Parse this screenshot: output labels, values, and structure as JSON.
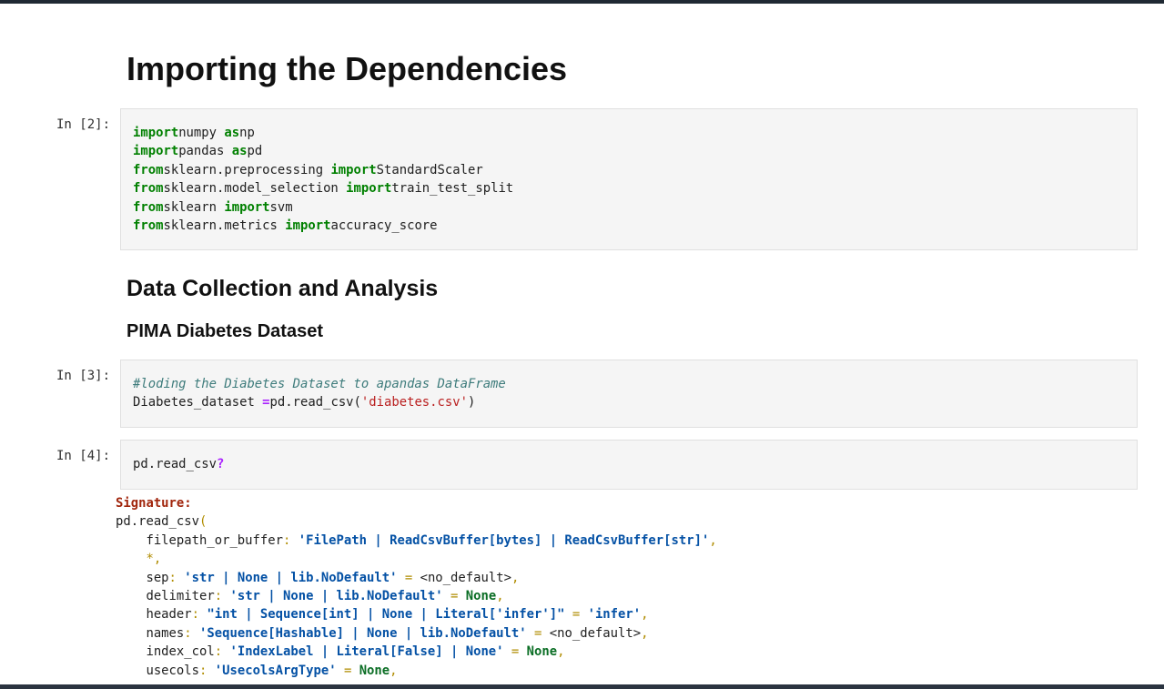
{
  "headings": {
    "h1": "Importing the Dependencies",
    "h2": "Data Collection and Analysis",
    "h3": "PIMA Diabetes Dataset"
  },
  "cells": [
    {
      "prompt": "In [2]:",
      "lines": [
        [
          [
            "kw",
            "import"
          ],
          [
            "",
            "numpy "
          ],
          [
            "kw",
            "as"
          ],
          [
            "",
            "np"
          ]
        ],
        [
          [
            "kw",
            "import"
          ],
          [
            "",
            "pandas "
          ],
          [
            "kw",
            "as"
          ],
          [
            "",
            "pd"
          ]
        ],
        [
          [
            "kw",
            "from"
          ],
          [
            "",
            "sklearn.preprocessing "
          ],
          [
            "kw",
            "import"
          ],
          [
            "",
            "StandardScaler"
          ]
        ],
        [
          [
            "kw",
            "from"
          ],
          [
            "",
            "sklearn.model_selection "
          ],
          [
            "kw",
            "import"
          ],
          [
            "",
            "train_test_split"
          ]
        ],
        [
          [
            "kw",
            "from"
          ],
          [
            "",
            "sklearn "
          ],
          [
            "kw",
            "import"
          ],
          [
            "",
            "svm"
          ]
        ],
        [
          [
            "kw",
            "from"
          ],
          [
            "",
            "sklearn.metrics "
          ],
          [
            "kw",
            "import"
          ],
          [
            "",
            "accuracy_score"
          ]
        ]
      ]
    },
    {
      "prompt": "In [3]:",
      "lines": [
        [
          [
            "cm",
            "#loding the Diabetes Dataset to apandas DataFrame"
          ]
        ],
        [
          [
            "",
            "Diabetes_dataset "
          ],
          [
            "op",
            "="
          ],
          [
            "",
            "pd.read_csv("
          ],
          [
            "st",
            "'diabetes.csv'"
          ],
          [
            "",
            ")"
          ]
        ]
      ]
    },
    {
      "prompt": "In [4]:",
      "lines": [
        [
          [
            "",
            "pd.read_csv"
          ],
          [
            "op",
            "?"
          ]
        ]
      ]
    }
  ],
  "output": {
    "lines": [
      [
        [
          "sigl",
          "Signature:"
        ]
      ],
      [
        [
          "",
          "pd.read_csv"
        ],
        [
          "pu",
          "("
        ]
      ],
      [
        [
          "",
          "    filepath_or_buffer"
        ],
        [
          "pu",
          ":"
        ],
        [
          "",
          " "
        ],
        [
          "ann",
          "'FilePath | ReadCsvBuffer[bytes] | ReadCsvBuffer[str]'"
        ],
        [
          "pu",
          ","
        ]
      ],
      [
        [
          "",
          "    "
        ],
        [
          "pu",
          "*,"
        ]
      ],
      [
        [
          "",
          "    sep"
        ],
        [
          "pu",
          ":"
        ],
        [
          "",
          " "
        ],
        [
          "ann",
          "'str | None | lib.NoDefault'"
        ],
        [
          "",
          " "
        ],
        [
          "pu",
          "="
        ],
        [
          "",
          " <no_default>"
        ],
        [
          "pu",
          ","
        ]
      ],
      [
        [
          "",
          "    delimiter"
        ],
        [
          "pu",
          ":"
        ],
        [
          "",
          " "
        ],
        [
          "ann",
          "'str | None | lib.NoDefault'"
        ],
        [
          "",
          " "
        ],
        [
          "pu",
          "="
        ],
        [
          "",
          " "
        ],
        [
          "def",
          "None"
        ],
        [
          "pu",
          ","
        ]
      ],
      [
        [
          "",
          "    header"
        ],
        [
          "pu",
          ":"
        ],
        [
          "",
          " "
        ],
        [
          "ann",
          "\"int | Sequence[int] | None | Literal['infer']\""
        ],
        [
          "",
          " "
        ],
        [
          "pu",
          "="
        ],
        [
          "",
          " "
        ],
        [
          "ann",
          "'infer'"
        ],
        [
          "pu",
          ","
        ]
      ],
      [
        [
          "",
          "    names"
        ],
        [
          "pu",
          ":"
        ],
        [
          "",
          " "
        ],
        [
          "ann",
          "'Sequence[Hashable] | None | lib.NoDefault'"
        ],
        [
          "",
          " "
        ],
        [
          "pu",
          "="
        ],
        [
          "",
          " <no_default>"
        ],
        [
          "pu",
          ","
        ]
      ],
      [
        [
          "",
          "    index_col"
        ],
        [
          "pu",
          ":"
        ],
        [
          "",
          " "
        ],
        [
          "ann",
          "'IndexLabel | Literal[False] | None'"
        ],
        [
          "",
          " "
        ],
        [
          "pu",
          "="
        ],
        [
          "",
          " "
        ],
        [
          "def",
          "None"
        ],
        [
          "pu",
          ","
        ]
      ],
      [
        [
          "",
          "    usecols"
        ],
        [
          "pu",
          ":"
        ],
        [
          "",
          " "
        ],
        [
          "ann",
          "'UsecolsArgType'"
        ],
        [
          "",
          " "
        ],
        [
          "pu",
          "="
        ],
        [
          "",
          " "
        ],
        [
          "def",
          "None"
        ],
        [
          "pu",
          ","
        ]
      ]
    ]
  }
}
